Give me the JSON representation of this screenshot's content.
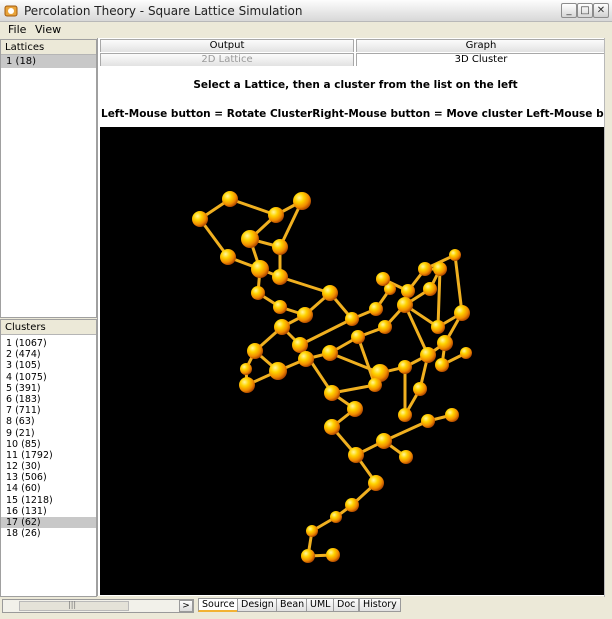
{
  "window": {
    "title": "Percolation Theory - Square Lattice Simulation",
    "minimize_glyph": "_",
    "maximize_glyph": "□",
    "close_glyph": "✕"
  },
  "menu": {
    "file": "File",
    "view": "View"
  },
  "lattices": {
    "header": "Lattices",
    "items": [
      "1 (18)"
    ]
  },
  "clusters": {
    "header": "Clusters",
    "items": [
      "1 (1067)",
      "2 (474)",
      "3 (105)",
      "4 (1075)",
      "5 (391)",
      "6 (183)",
      "7 (711)",
      "8 (63)",
      "9 (21)",
      "10 (85)",
      "11 (1792)",
      "12 (30)",
      "13 (506)",
      "14 (60)",
      "15 (1218)",
      "16 (131)",
      "17 (62)",
      "18 (26)"
    ],
    "selected": "17 (62)"
  },
  "tabs": {
    "output": "Output",
    "graph": "Graph",
    "lattice_2d": "2D Lattice",
    "cluster_3d": "3D Cluster"
  },
  "instructions": {
    "line1": "Select a Lattice, then a cluster from the list on the left",
    "line2": "Left-Mouse button = Rotate ClusterRight-Mouse button = Move cluster Left-Mouse button + Left-Alt key = Zoom"
  },
  "bottom_tabs": [
    "Source",
    "Design",
    "Bean",
    "UML",
    "Doc",
    "History"
  ],
  "scrollbar": {
    "left_glyph": "<",
    "right_glyph": ">",
    "grip": "|||"
  },
  "colors": {
    "sphere_core": "#ffd400",
    "sphere_edge": "#e06a00",
    "bond": "#f0b020",
    "canvas_bg": "#000000"
  },
  "icons": [
    "app-icon",
    "minimize-icon",
    "maximize-icon",
    "close-icon"
  ]
}
